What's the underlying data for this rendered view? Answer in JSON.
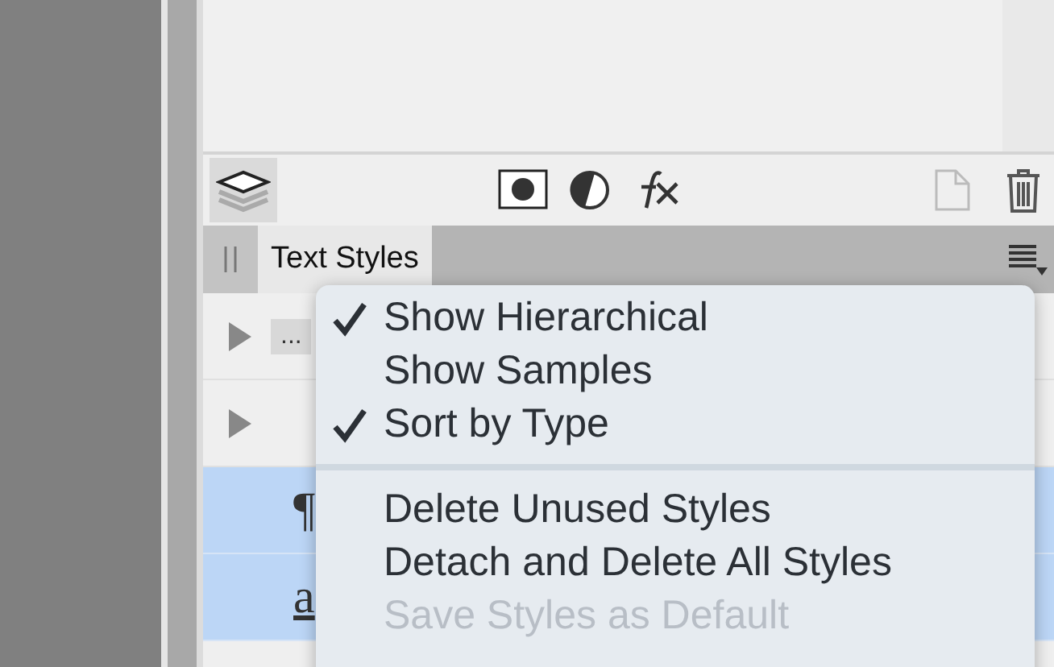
{
  "toolbar": {
    "layers_selected": true
  },
  "panel": {
    "tab": {
      "label": "Text Styles",
      "selected": true
    }
  },
  "rows": [
    {
      "kind": "group",
      "label": "...",
      "selected": false
    },
    {
      "kind": "group",
      "selected": false
    },
    {
      "kind": "style",
      "label": "¶",
      "selected": true
    },
    {
      "kind": "style",
      "label": "a",
      "selected": true
    }
  ],
  "menu": [
    {
      "kind": "item",
      "label": "Show Hierarchical",
      "checked": true,
      "disabled": false
    },
    {
      "kind": "item",
      "label": "Show Samples",
      "checked": false,
      "disabled": false
    },
    {
      "kind": "item",
      "label": "Sort by Type",
      "checked": true,
      "disabled": false
    },
    {
      "kind": "separator"
    },
    {
      "kind": "item",
      "label": "Delete Unused Styles",
      "checked": false,
      "disabled": false
    },
    {
      "kind": "item",
      "label": "Detach and Delete All Styles",
      "checked": false,
      "disabled": false
    },
    {
      "kind": "item",
      "label": "Save Styles as Default",
      "checked": false,
      "disabled": true
    }
  ]
}
